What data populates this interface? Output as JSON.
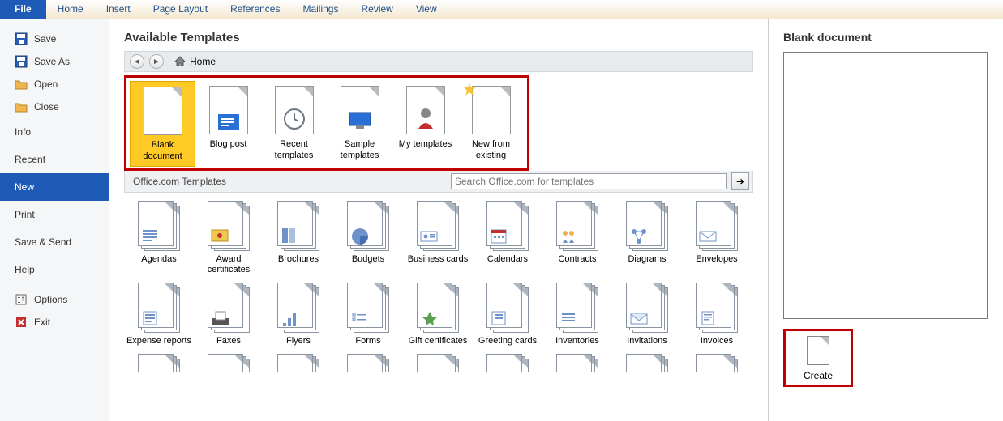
{
  "ribbon": {
    "tabs": [
      "File",
      "Home",
      "Insert",
      "Page Layout",
      "References",
      "Mailings",
      "Review",
      "View"
    ]
  },
  "sidebar": {
    "items_icon": [
      {
        "label": "Save"
      },
      {
        "label": "Save As"
      },
      {
        "label": "Open"
      },
      {
        "label": "Close"
      }
    ],
    "sections": [
      {
        "label": "Info"
      },
      {
        "label": "Recent"
      },
      {
        "label": "New"
      },
      {
        "label": "Print"
      },
      {
        "label": "Save & Send"
      },
      {
        "label": "Help"
      }
    ],
    "footer": [
      {
        "label": "Options"
      },
      {
        "label": "Exit"
      }
    ]
  },
  "center": {
    "heading": "Available Templates",
    "breadcrumb": "Home",
    "top_templates": [
      {
        "label": "Blank document"
      },
      {
        "label": "Blog post"
      },
      {
        "label": "Recent templates"
      },
      {
        "label": "Sample templates"
      },
      {
        "label": "My templates"
      },
      {
        "label": "New from existing"
      }
    ],
    "office_label": "Office.com Templates",
    "search_placeholder": "Search Office.com for templates",
    "grid": [
      "Agendas",
      "Award certificates",
      "Brochures",
      "Budgets",
      "Business cards",
      "Calendars",
      "Contracts",
      "Diagrams",
      "Envelopes",
      "Expense reports",
      "Faxes",
      "Flyers",
      "Forms",
      "Gift certificates",
      "Greeting cards",
      "Inventories",
      "Invitations",
      "Invoices"
    ]
  },
  "preview": {
    "title": "Blank document",
    "create": "Create"
  }
}
